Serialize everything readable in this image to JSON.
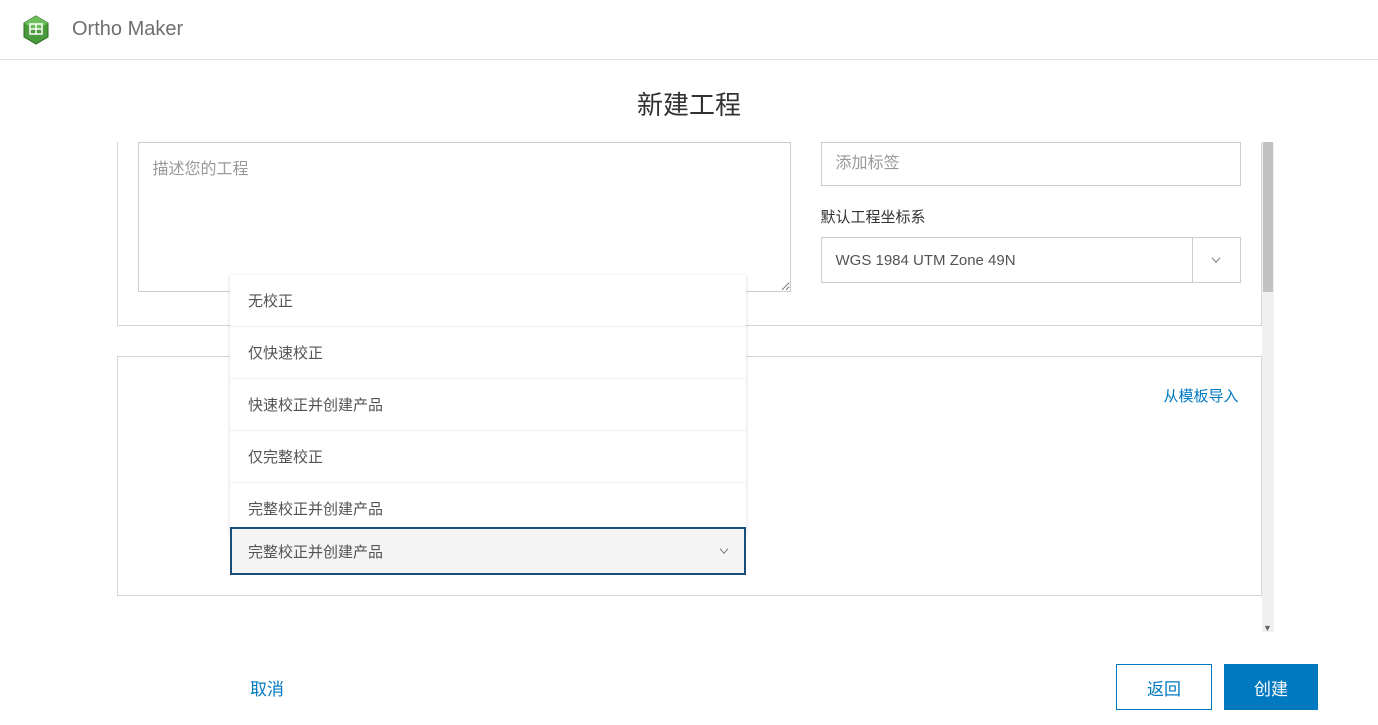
{
  "header": {
    "app_title": "Ortho Maker"
  },
  "page": {
    "title": "新建工程"
  },
  "upper": {
    "description_placeholder": "描述您的工程",
    "tags_placeholder": "添加标签",
    "coord_label": "默认工程坐标系",
    "coord_value": "WGS 1984 UTM Zone 49N"
  },
  "lower": {
    "import_link": "从模板导入",
    "combo_selected": "完整校正并创建产品",
    "dropdown_options": [
      "无校正",
      "仅快速校正",
      "快速校正并创建产品",
      "仅完整校正",
      "完整校正并创建产品"
    ]
  },
  "footer": {
    "cancel": "取消",
    "back": "返回",
    "create": "创建"
  },
  "colors": {
    "primary": "#0079c1",
    "logo_green": "#4a9b3e"
  }
}
